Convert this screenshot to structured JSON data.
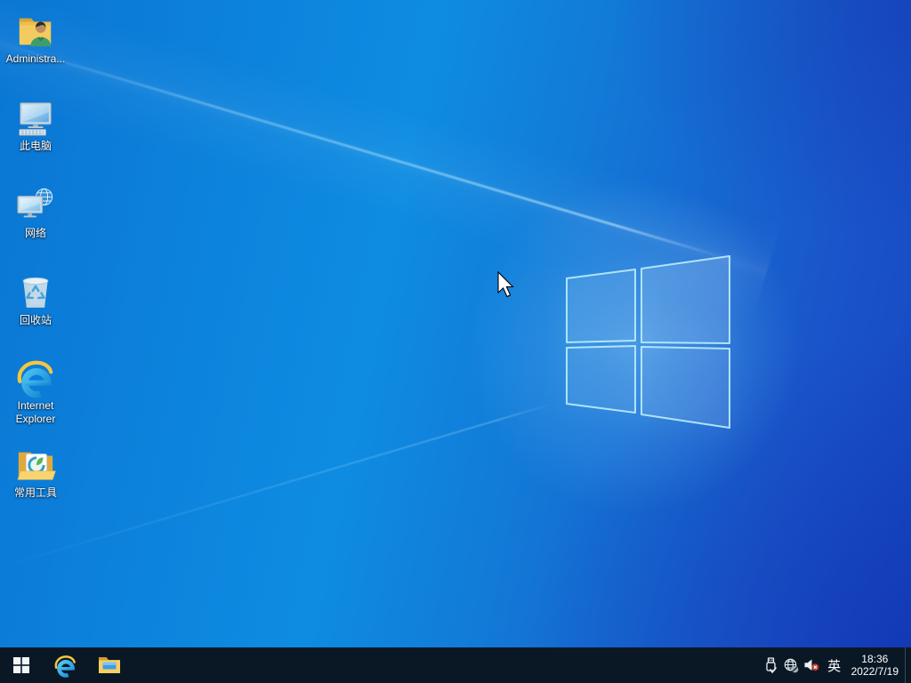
{
  "desktop": {
    "icons": [
      {
        "name": "administrator-folder",
        "label": "Administra..."
      },
      {
        "name": "this-pc",
        "label": "此电脑"
      },
      {
        "name": "network",
        "label": "网络"
      },
      {
        "name": "recycle-bin",
        "label": "回收站"
      },
      {
        "name": "internet-explorer",
        "label": "Internet Explorer"
      },
      {
        "name": "common-tools",
        "label": "常用工具"
      }
    ],
    "wallpaper": {
      "azure": "#0e8ce2",
      "royal": "#1546c2",
      "logo_stroke": "#b9ecfc"
    }
  },
  "taskbar": {
    "background": "#0a1826",
    "pinned_icons": [
      "start-icon",
      "internet-explorer-icon",
      "file-explorer-icon"
    ],
    "tray": {
      "icons": [
        "usb-safely-remove-icon",
        "network-offline-icon",
        "volume-muted-icon"
      ],
      "ime_indicator": "英",
      "time": "18:36",
      "date": "2022/7/19"
    }
  }
}
